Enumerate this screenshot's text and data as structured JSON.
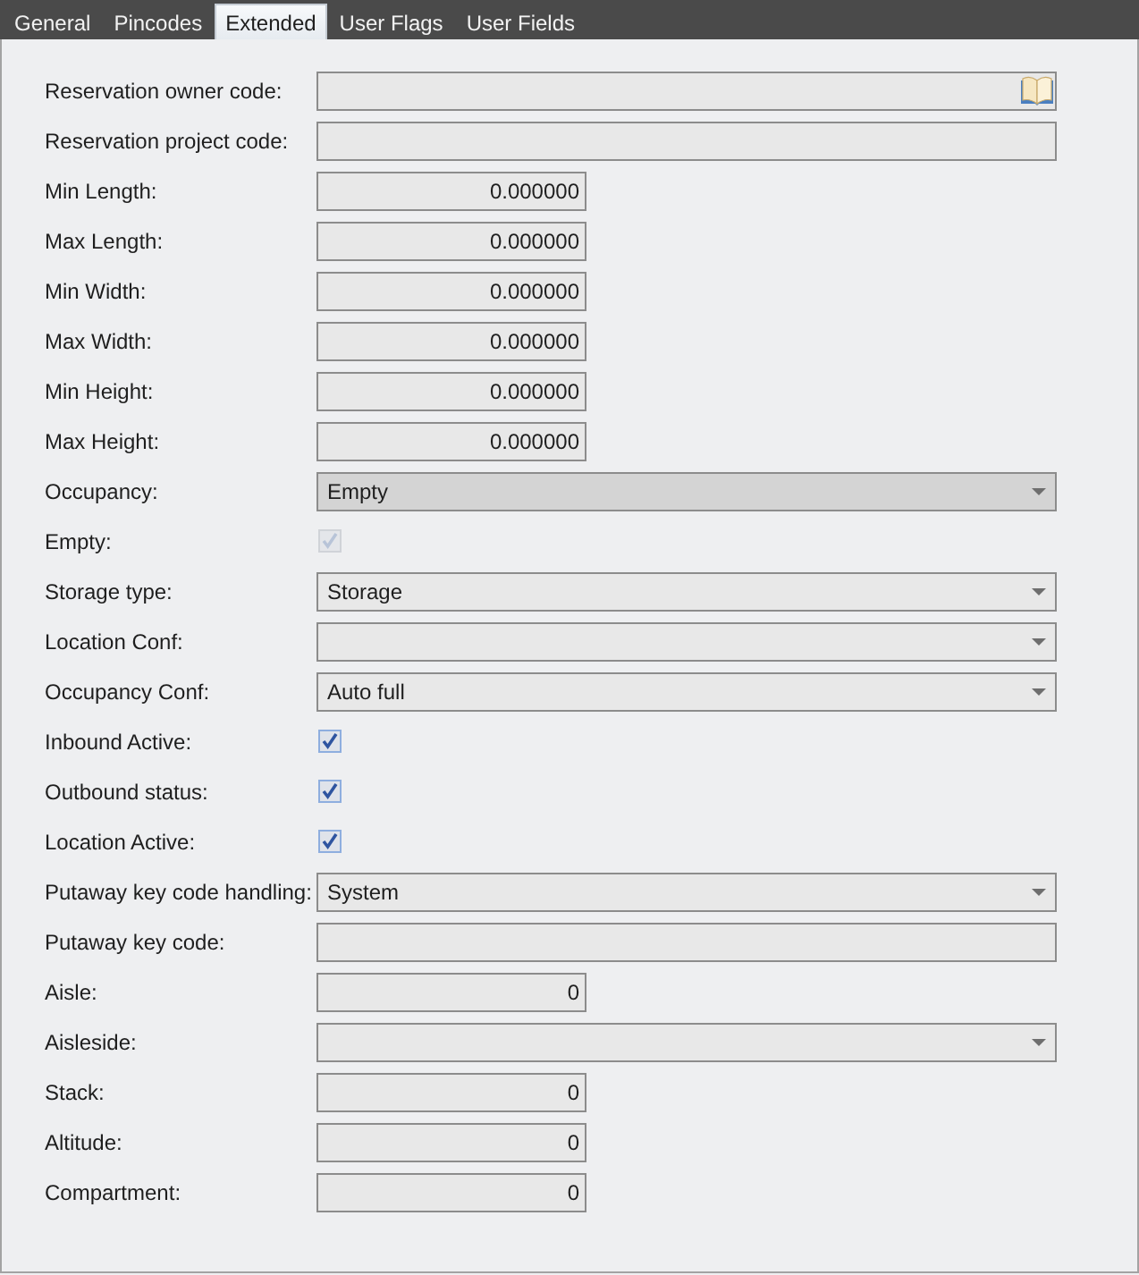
{
  "tabs": [
    {
      "label": "General",
      "selected": false
    },
    {
      "label": "Pincodes",
      "selected": false
    },
    {
      "label": "Extended",
      "selected": true
    },
    {
      "label": "User Flags",
      "selected": false
    },
    {
      "label": "User Fields",
      "selected": false
    }
  ],
  "fields": [
    {
      "label": "Reservation owner code:",
      "kind": "lookup",
      "disabled": false
    },
    {
      "label": "Reservation project code:",
      "kind": "text",
      "disabled": false
    },
    {
      "label": "Min Length:",
      "kind": "number",
      "value": "0.000000",
      "disabled": false
    },
    {
      "label": "Max Length:",
      "kind": "number",
      "value": "0.000000",
      "disabled": false
    },
    {
      "label": "Min Width:",
      "kind": "number",
      "value": "0.000000",
      "disabled": false
    },
    {
      "label": "Max Width:",
      "kind": "number",
      "value": "0.000000",
      "disabled": false
    },
    {
      "label": "Min Height:",
      "kind": "number",
      "value": "0.000000",
      "disabled": false
    },
    {
      "label": "Max Height:",
      "kind": "number",
      "value": "0.000000",
      "disabled": false
    },
    {
      "label": "Occupancy:",
      "kind": "combo",
      "value": "Empty",
      "disabled": true
    },
    {
      "label": "Empty:",
      "kind": "checkbox",
      "checked": true,
      "disabled": true
    },
    {
      "label": "Storage type:",
      "kind": "combo",
      "value": "Storage",
      "disabled": false
    },
    {
      "label": "Location Conf:",
      "kind": "combo",
      "disabled": false
    },
    {
      "label": "Occupancy Conf:",
      "kind": "combo",
      "value": "Auto full",
      "disabled": false
    },
    {
      "label": "Inbound Active:",
      "kind": "checkbox",
      "checked": true,
      "disabled": false
    },
    {
      "label": "Outbound status:",
      "kind": "checkbox",
      "checked": true,
      "disabled": false
    },
    {
      "label": "Location Active:",
      "kind": "checkbox",
      "checked": true,
      "disabled": false
    },
    {
      "label": "Putaway key code handling:",
      "kind": "combo",
      "value": "System",
      "disabled": false
    },
    {
      "label": "Putaway key code:",
      "kind": "text",
      "disabled": false
    },
    {
      "label": "Aisle:",
      "kind": "number",
      "value": "0",
      "disabled": false
    },
    {
      "label": "Aisleside:",
      "kind": "combo",
      "disabled": false
    },
    {
      "label": "Stack:",
      "kind": "number",
      "value": "0",
      "disabled": false
    },
    {
      "label": "Altitude:",
      "kind": "number",
      "value": "0",
      "disabled": false
    },
    {
      "label": "Compartment:",
      "kind": "number",
      "value": "0",
      "disabled": false
    }
  ]
}
